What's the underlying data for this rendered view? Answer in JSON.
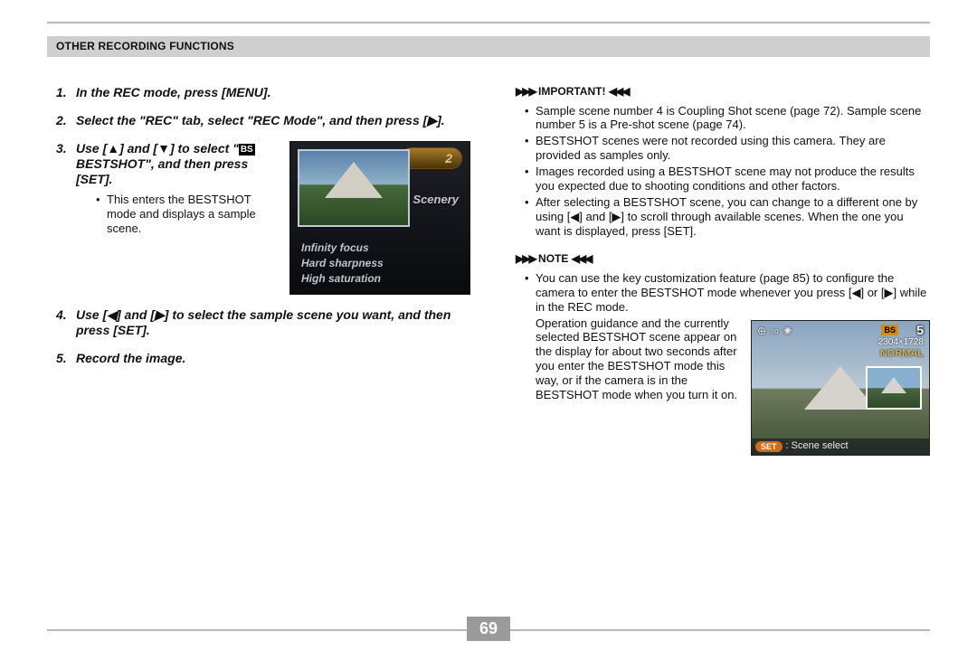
{
  "header": "OTHER RECORDING FUNCTIONS",
  "steps": {
    "s1": {
      "num": "1.",
      "text": "In the REC mode, press [MENU]."
    },
    "s2": {
      "num": "2.",
      "text": "Select the \"REC\" tab, select \"REC Mode\", and then press [▶]."
    },
    "s3": {
      "num": "3.",
      "pre": "Use [▲] and [▼] to select \"",
      "bs": "BS",
      "post": " BESTSHOT\", and then press [SET].",
      "bullet": "This enters the BESTSHOT mode and displays a sample scene."
    },
    "s4": {
      "num": "4.",
      "text": "Use [◀] and [▶] to select the sample scene you want, and then press [SET]."
    },
    "s5": {
      "num": "5.",
      "text": "Record the image."
    }
  },
  "preview1": {
    "number": "2",
    "label": "Scenery",
    "props": [
      "Infinity focus",
      "Hard sharpness",
      "High saturation"
    ]
  },
  "important": {
    "head": "IMPORTANT!",
    "items": [
      "Sample scene number 4 is Coupling Shot scene (page 72). Sample scene number 5 is a Pre-shot scene (page 74).",
      "BESTSHOT scenes were not recorded using this camera. They are provided as samples only.",
      "Images recorded using a BESTSHOT scene may not produce the results you expected due to shooting conditions and other factors.",
      "After selecting a BESTSHOT scene, you can change to a different one by using [◀] and [▶] to scroll through available scenes. When the one you want is displayed, press [SET]."
    ]
  },
  "note": {
    "head": "NOTE",
    "b1": "You can use the key customization feature (page 85) to configure the camera to enter the BESTSHOT mode whenever you press [◀] or [▶] while in the REC mode.",
    "para": "Operation guidance and the currently selected BESTSHOT scene appear on the display for about two seconds after you enter the BESTSHOT mode this way, or if the camera is in the BESTSHOT mode when you turn it on."
  },
  "preview2": {
    "bs": "BS",
    "count": "5",
    "resolution": "2304×1728",
    "normal": "NORMAL",
    "set": "SET",
    "overlay": ": Scene select"
  },
  "page_number": "69"
}
